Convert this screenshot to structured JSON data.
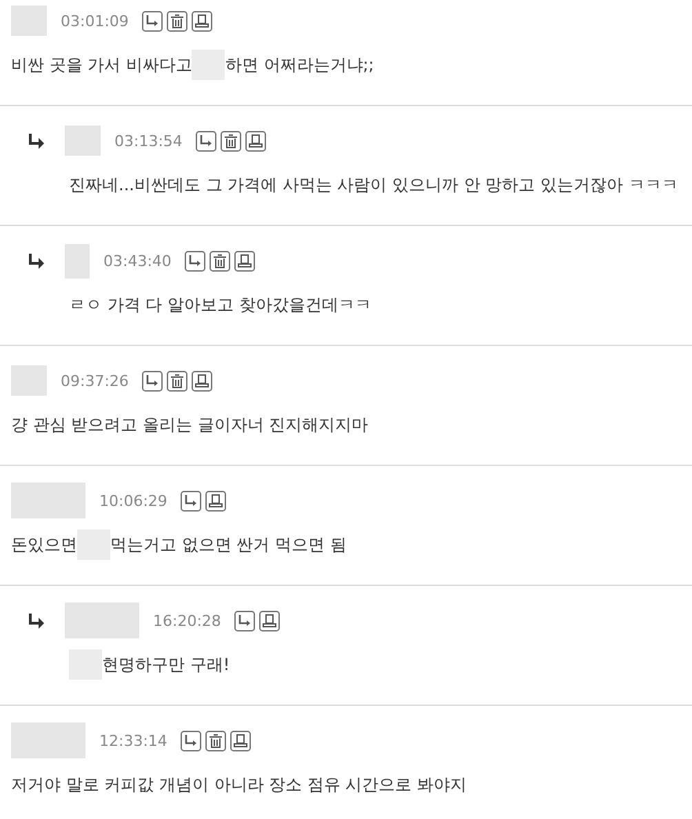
{
  "comments": [
    {
      "reply": false,
      "avatar": {
        "kind": "medium"
      },
      "time": "03:01:09",
      "buttons": [
        {
          "kind": "reply"
        },
        {
          "kind": "delete"
        },
        {
          "kind": "report"
        }
      ],
      "body": [
        {
          "kind": "text",
          "text": "비싼 곳을 가서 비싸다고 "
        },
        {
          "kind": "redacted"
        },
        {
          "kind": "text",
          "text": "하면 어쩌라는거냐;;"
        }
      ]
    },
    {
      "reply": true,
      "avatar": {
        "kind": "medium"
      },
      "time": "03:13:54",
      "buttons": [
        {
          "kind": "reply"
        },
        {
          "kind": "delete"
        },
        {
          "kind": "report"
        }
      ],
      "body": [
        {
          "kind": "text",
          "text": "진짜네...비싼데도 그 가격에 사먹는 사람이 있으니까 안 망하고 있는거잖아 ㅋㅋㅋ"
        }
      ]
    },
    {
      "reply": true,
      "avatar": {
        "kind": "narrow"
      },
      "time": "03:43:40",
      "buttons": [
        {
          "kind": "reply"
        },
        {
          "kind": "delete"
        },
        {
          "kind": "report"
        }
      ],
      "body": [
        {
          "kind": "text",
          "text": "ㄹㅇ 가격 다 알아보고 찾아갔을건데ㅋㅋ"
        }
      ]
    },
    {
      "reply": false,
      "avatar": {
        "kind": "medium"
      },
      "time": "09:37:26",
      "buttons": [
        {
          "kind": "reply"
        },
        {
          "kind": "delete"
        },
        {
          "kind": "report"
        }
      ],
      "body": [
        {
          "kind": "text",
          "text": "걍 관심 받으려고 올리는 글이자너 진지해지지마"
        }
      ]
    },
    {
      "reply": false,
      "avatar": {
        "kind": "wide"
      },
      "time": "10:06:29",
      "buttons": [
        {
          "kind": "reply"
        },
        {
          "kind": "report"
        }
      ],
      "body": [
        {
          "kind": "text",
          "text": "돈있으면"
        },
        {
          "kind": "redacted"
        },
        {
          "kind": "text",
          "text": "먹는거고 없으면 싼거 먹으면 됨"
        }
      ]
    },
    {
      "reply": true,
      "avatar": {
        "kind": "wide"
      },
      "time": "16:20:28",
      "buttons": [
        {
          "kind": "reply"
        },
        {
          "kind": "report"
        }
      ],
      "body": [
        {
          "kind": "redacted"
        },
        {
          "kind": "text",
          "text": "현명하구만 구래!"
        }
      ]
    },
    {
      "reply": false,
      "avatar": {
        "kind": "wide"
      },
      "time": "12:33:14",
      "buttons": [
        {
          "kind": "reply"
        },
        {
          "kind": "delete"
        },
        {
          "kind": "report"
        }
      ],
      "body": [
        {
          "kind": "text",
          "text": "저거야 말로 커피값 개념이 아니라 장소 점유 시간으로 봐야지"
        }
      ]
    }
  ]
}
